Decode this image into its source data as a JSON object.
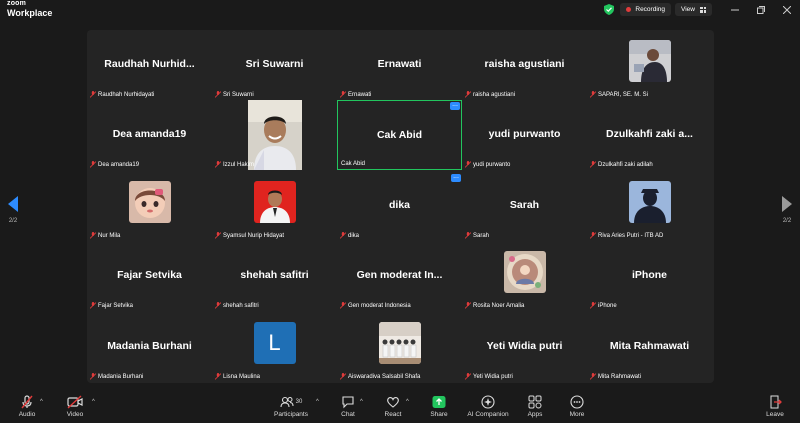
{
  "app": {
    "brand_top": "zoom",
    "brand_bottom": "Workplace",
    "recording_label": "Recording",
    "view_label": "View"
  },
  "pager": {
    "left": "2/2",
    "right": "2/2"
  },
  "tiles": [
    {
      "display": "Raudhah  Nurhid...",
      "label": "Raudhah Nurhidayati"
    },
    {
      "display": "Sri Suwarni",
      "label": "Sri Suwarni"
    },
    {
      "display": "Ernawati",
      "label": "Ernawati"
    },
    {
      "display": "raisha agustiani",
      "label": "raisha agustiani"
    },
    {
      "display": "",
      "label": "SAPARI, SE. M. Si"
    },
    {
      "display": "Dea amanda19",
      "label": "Dea amanda19"
    },
    {
      "display": "",
      "label": "Izzul Hakim"
    },
    {
      "display": "Cak Abid",
      "label": "Cak Abid"
    },
    {
      "display": "yudi purwanto",
      "label": "yudi purwanto"
    },
    {
      "display": "Dzulkahfi zaki a...",
      "label": "Dzulkahfi zaki adilah"
    },
    {
      "display": "",
      "label": "Nur Mila"
    },
    {
      "display": "",
      "label": "Syamsul Nurip Hidayat"
    },
    {
      "display": "dika",
      "label": "dika"
    },
    {
      "display": "Sarah",
      "label": "Sarah"
    },
    {
      "display": "",
      "label": "Riva Aries Putri - ITB AD"
    },
    {
      "display": "Fajar Setvika",
      "label": "Fajar Setvika"
    },
    {
      "display": "shehah safitri",
      "label": "shehah safitri"
    },
    {
      "display": "Gen moderat In...",
      "label": "Gen moderat Indonesia"
    },
    {
      "display": "",
      "label": "Rosita Noer Amalia"
    },
    {
      "display": "iPhone",
      "label": "iPhone"
    },
    {
      "display": "Madania Burhani",
      "label": "Madania Burhani"
    },
    {
      "display": "",
      "label": "Lisna Maulina",
      "avatar_letter": "L"
    },
    {
      "display": "",
      "label": "Aiswaradiva Salsabil Shafa"
    },
    {
      "display": "Yeti Widia putri",
      "label": "Yeti Widia putri"
    },
    {
      "display": "Mita Rahmawati",
      "label": "Mita Rahmawati"
    }
  ],
  "toolbar": {
    "audio": "Audio",
    "video": "Video",
    "participants": "Participants",
    "participants_count": "30",
    "chat": "Chat",
    "react": "React",
    "share": "Share",
    "ai_companion": "AI Companion",
    "apps": "Apps",
    "more": "More",
    "leave": "Leave"
  },
  "colors": {
    "background": "#1a1a1a",
    "tile_bg": "#242424",
    "accent_blue": "#2d8cff",
    "active_speaker": "#22c55e",
    "share_green": "#22c55e",
    "muted_red": "#e03b3b"
  }
}
